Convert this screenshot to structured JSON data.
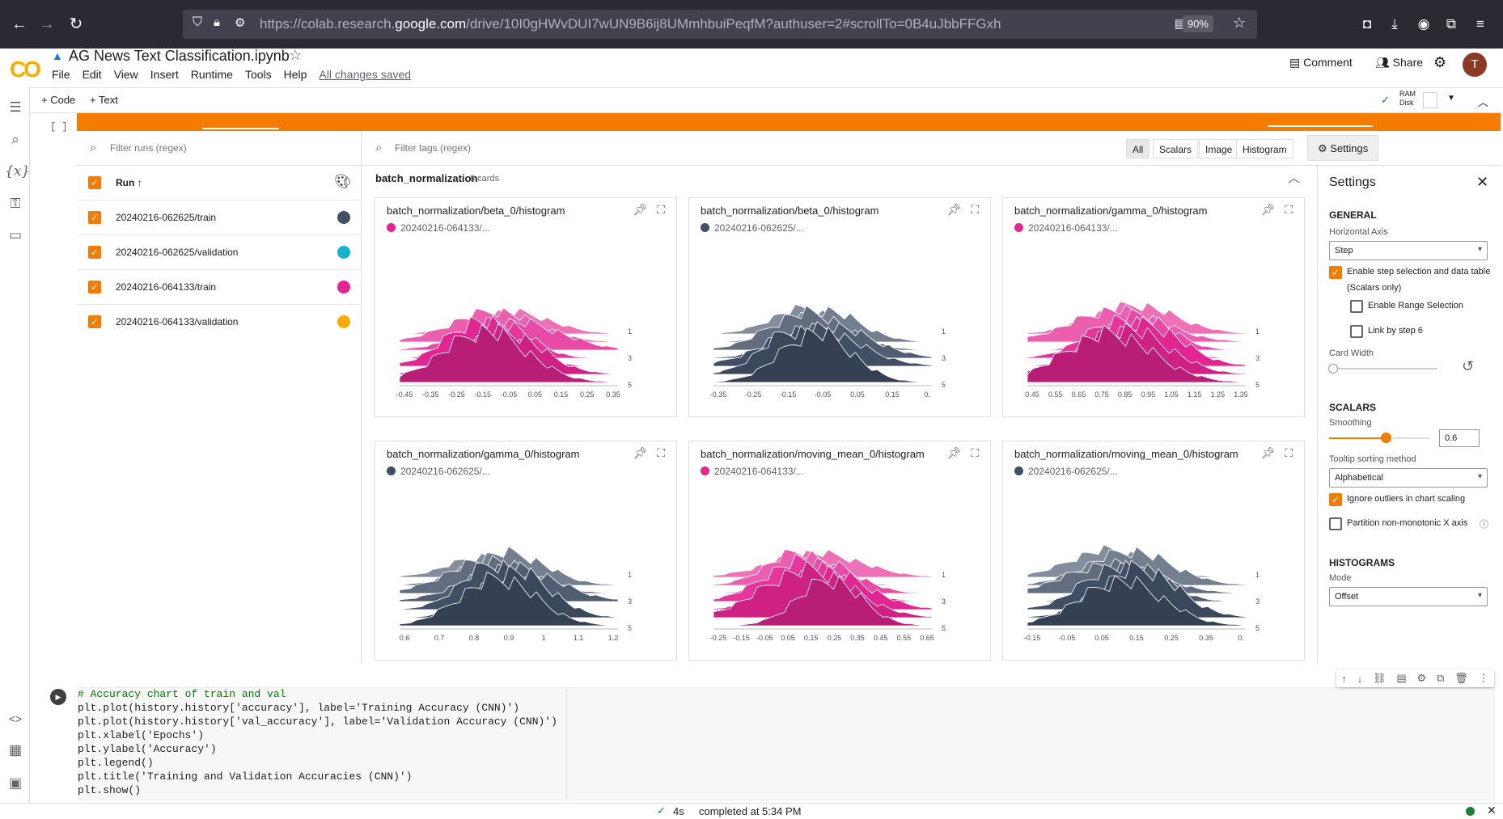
{
  "browser": {
    "url_prefix": "https://colab.research.",
    "url_domain": "google.com",
    "url_suffix": "/drive/10I0gHWvDUI7wUN9B6ij8UMmhbuiPeqfM?authuser=2#scrollTo=0B4uJbbFFGxh",
    "zoom": "90%"
  },
  "colab": {
    "notebook_title": "AG News Text Classification.ipynb",
    "menu": [
      "File",
      "Edit",
      "View",
      "Insert",
      "Runtime",
      "Tools",
      "Help"
    ],
    "saved_status": "All changes saved",
    "comment_label": "Comment",
    "share_label": "Share",
    "avatar_letter": "T",
    "add_code": "+ Code",
    "add_text": "+ Text",
    "ram_label": "RAM",
    "disk_label": "Disk",
    "cell_bracket": "[ ]"
  },
  "tensorboard": {
    "runs_filter_placeholder": "Filter runs (regex)",
    "tags_filter_placeholder": "Filter tags (regex)",
    "run_header": "Run ↑",
    "runs": [
      {
        "label": "20240216-062625/train",
        "color": "#425066"
      },
      {
        "label": "20240216-062625/validation",
        "color": "#12b5cb"
      },
      {
        "label": "20240216-064133/train",
        "color": "#e52592"
      },
      {
        "label": "20240216-064133/validation",
        "color": "#f9ab00"
      }
    ],
    "tabs": [
      "All",
      "Scalars",
      "Image",
      "Histogram"
    ],
    "settings_button": "Settings",
    "group_name": "batch_normalization",
    "group_count": "8 cards",
    "cards": [
      {
        "title": "batch_normalization/beta_0/histogram",
        "run": "20240216-064133/...",
        "color": "#e52592",
        "ticks": [
          "-0.45",
          "-0.35",
          "-0.25",
          "-0.15",
          "-0.05",
          "0.05",
          "0.15",
          "0.25",
          "0.35"
        ],
        "steps": [
          "1",
          "3",
          "5"
        ]
      },
      {
        "title": "batch_normalization/beta_0/histogram",
        "run": "20240216-062625/...",
        "color": "#425066",
        "ticks": [
          "-0.35",
          "-0.25",
          "-0.15",
          "-0.05",
          "0.05",
          "0.15",
          "0."
        ],
        "steps": [
          "1",
          "3",
          "5"
        ]
      },
      {
        "title": "batch_normalization/gamma_0/histogram",
        "run": "20240216-064133/...",
        "color": "#e52592",
        "ticks": [
          "0.45",
          "0.55",
          "0.65",
          "0.75",
          "0.85",
          "0.95",
          "1.05",
          "1.15",
          "1.25",
          "1.35"
        ],
        "steps": [
          "1",
          "3",
          "5"
        ]
      },
      {
        "title": "batch_normalization/gamma_0/histogram",
        "run": "20240216-062625/...",
        "color": "#425066",
        "ticks": [
          "0.6",
          "0.7",
          "0.8",
          "0.9",
          "1",
          "1.1",
          "1.2"
        ],
        "steps": [
          "1",
          "3",
          "5"
        ]
      },
      {
        "title": "batch_normalization/moving_mean_0/histogram",
        "run": "20240216-064133/...",
        "color": "#e52592",
        "ticks": [
          "-0.25",
          "-0.15",
          "-0.05",
          "0.05",
          "0.15",
          "0.25",
          "0.35",
          "0.45",
          "0.55",
          "0.65"
        ],
        "steps": [
          "1",
          "3",
          "5"
        ]
      },
      {
        "title": "batch_normalization/moving_mean_0/histogram",
        "run": "20240216-062625/...",
        "color": "#425066",
        "ticks": [
          "-0.15",
          "-0.05",
          "0.05",
          "0.15",
          "0.25",
          "0.35",
          "0."
        ],
        "steps": [
          "1",
          "3",
          "5"
        ]
      }
    ],
    "settings": {
      "title": "Settings",
      "general": "GENERAL",
      "horizontal_axis_label": "Horizontal Axis",
      "horizontal_axis_value": "Step",
      "enable_step": "Enable step selection and data table",
      "scalars_only": "(Scalars only)",
      "enable_range": "Enable Range Selection",
      "link_by_step": "Link by step 6",
      "card_width": "Card Width",
      "scalars": "SCALARS",
      "smoothing": "Smoothing",
      "smoothing_value": "0.6",
      "tooltip_sort": "Tooltip sorting method",
      "tooltip_value": "Alphabetical",
      "ignore_outliers": "Ignore outliers in chart scaling",
      "partition": "Partition non-monotonic X axis",
      "histograms": "HISTOGRAMS",
      "mode": "Mode",
      "mode_value": "Offset"
    }
  },
  "code_cell": {
    "lines": [
      "# Accuracy chart of train and val",
      "plt.plot(history.history['accuracy'], label='Training Accuracy (CNN)')",
      "plt.plot(history.history['val_accuracy'], label='Validation Accuracy (CNN)')",
      "plt.xlabel('Epochs')",
      "plt.ylabel('Accuracy')",
      "plt.legend()",
      "plt.title('Training and Validation Accuracies (CNN)')",
      "plt.show()"
    ]
  },
  "status_bar": {
    "duration": "4s",
    "completed": "completed at 5:34 PM"
  }
}
